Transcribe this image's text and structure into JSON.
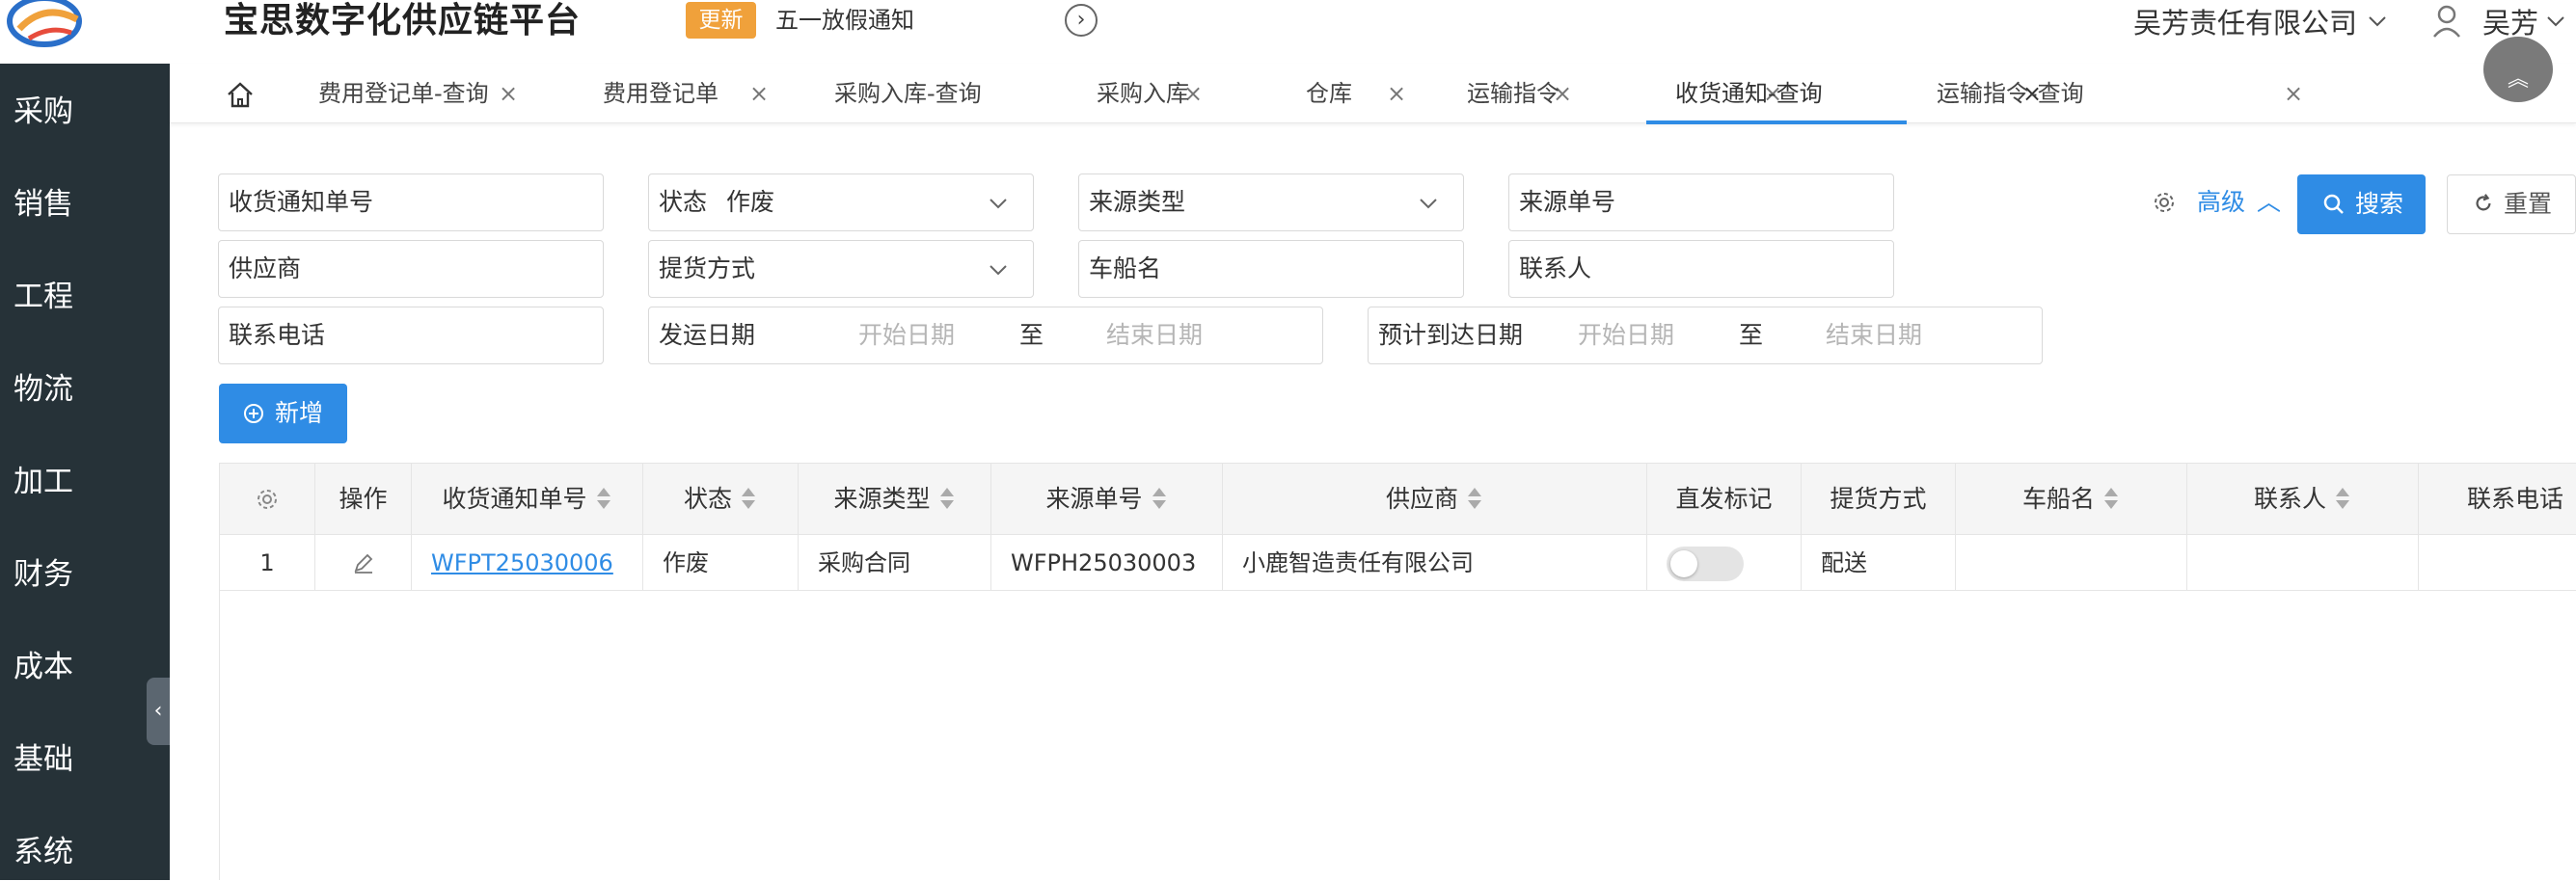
{
  "header": {
    "app_title": "宝思数字化供应链平台",
    "update_badge": "更新",
    "notice": "五一放假通知",
    "company": "吴芳责任有限公司",
    "user": "吴芳"
  },
  "sidebar": {
    "items": [
      {
        "label": "采购"
      },
      {
        "label": "销售"
      },
      {
        "label": "工程"
      },
      {
        "label": "物流"
      },
      {
        "label": "加工"
      },
      {
        "label": "财务"
      },
      {
        "label": "成本"
      },
      {
        "label": "基础"
      },
      {
        "label": "系统"
      }
    ]
  },
  "tabs": [
    {
      "label": "费用登记单-查询"
    },
    {
      "label": "费用登记单"
    },
    {
      "label": "采购入库-查询"
    },
    {
      "label": "采购入库"
    },
    {
      "label": "仓库"
    },
    {
      "label": "运输指令"
    },
    {
      "label": "收货通知-查询",
      "active": true
    },
    {
      "label": "运输指令-查询"
    }
  ],
  "filters": {
    "notice_no": "收货通知单号",
    "status_label": "状态",
    "status_value": "作废",
    "source_type": "来源类型",
    "source_no": "来源单号",
    "supplier": "供应商",
    "pickup_method": "提货方式",
    "vessel": "车船名",
    "contact": "联系人",
    "phone": "联系电话",
    "ship_date_label": "发运日期",
    "ship_date_start": "开始日期",
    "ship_date_to": "至",
    "ship_date_end": "结束日期",
    "eta_label": "预计到达日期",
    "eta_start": "开始日期",
    "eta_to": "至",
    "eta_end": "结束日期"
  },
  "actions": {
    "advanced": "高级",
    "search": "搜索",
    "reset": "重置",
    "add": "新增"
  },
  "table": {
    "columns": [
      "操作",
      "收货通知单号",
      "状态",
      "来源类型",
      "来源单号",
      "供应商",
      "直发标记",
      "提货方式",
      "车船名",
      "联系人",
      "联系电话"
    ],
    "rows": [
      {
        "index": "1",
        "notice_no": "WFPT25030006",
        "status": "作废",
        "source_type": "采购合同",
        "source_no": "WFPH25030003",
        "supplier": "小鹿智造责任有限公司",
        "direct": false,
        "pickup_method": "配送",
        "vessel": "",
        "contact": "",
        "phone": ""
      }
    ]
  },
  "colors": {
    "primary": "#2f8ce5",
    "sidebar_bg": "#263238",
    "badge": "#f0a13b"
  }
}
